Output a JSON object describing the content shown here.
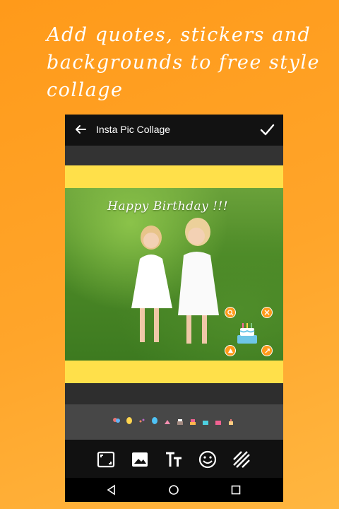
{
  "promo": {
    "line1": "Add quotes, stickers and",
    "line2": "backgrounds to free style",
    "line3": "collage"
  },
  "app": {
    "title": "Insta Pic Collage",
    "back_icon": "arrow-left-icon",
    "confirm_icon": "check-icon"
  },
  "canvas": {
    "background_color": "#ffe04a",
    "text_overlay": "Happy Birthday !!!",
    "sticker": "birthday-cake-sticker",
    "sticker_controls": [
      "zoom-icon",
      "close-icon",
      "flip-icon",
      "resize-icon"
    ]
  },
  "sticker_strip": {
    "items": [
      "balloons-sticker",
      "balloon-yellow-sticker",
      "confetti-sticker",
      "balloon-blue-sticker",
      "cake-slice-sticker",
      "cake-sticker",
      "cake-tier-sticker",
      "cake-blue-sticker",
      "cake-pink-sticker",
      "cake-small-sticker"
    ]
  },
  "toolbar": {
    "items": [
      "aspect-ratio-icon",
      "image-icon",
      "text-icon",
      "emoji-icon",
      "background-pattern-icon"
    ]
  },
  "navbar": {
    "items": [
      "nav-back-icon",
      "nav-home-icon",
      "nav-recents-icon"
    ]
  },
  "colors": {
    "background": "#ffa52a",
    "accent": "#ff9a1a",
    "appbar": "#121212"
  }
}
